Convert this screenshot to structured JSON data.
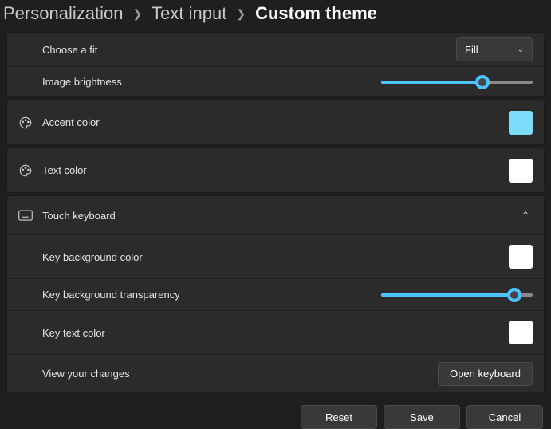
{
  "breadcrumb": {
    "items": [
      "Personalization",
      "Text input",
      "Custom theme"
    ]
  },
  "rows": {
    "choose_fit_label": "Choose a fit",
    "choose_fit_value": "Fill",
    "image_brightness_label": "Image brightness",
    "image_brightness_pct": 67,
    "accent_color_label": "Accent color",
    "accent_color_value": "#7cdcfa",
    "text_color_label": "Text color",
    "text_color_value": "#ffffff",
    "touch_keyboard_label": "Touch keyboard",
    "key_bg_color_label": "Key background color",
    "key_bg_color_value": "#ffffff",
    "key_bg_transparency_label": "Key background transparency",
    "key_bg_transparency_pct": 88,
    "key_text_color_label": "Key text color",
    "key_text_color_value": "#ffffff",
    "view_changes_label": "View your changes",
    "open_keyboard_label": "Open keyboard"
  },
  "footer": {
    "reset": "Reset",
    "save": "Save",
    "cancel": "Cancel"
  }
}
